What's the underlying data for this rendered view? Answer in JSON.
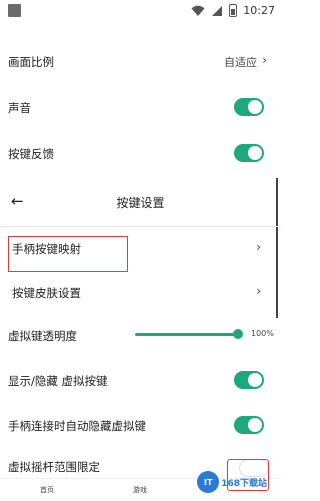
{
  "status": {
    "time": "10:27"
  },
  "settings_top": [
    {
      "label": "画面比例",
      "value": "自适应"
    },
    {
      "label": "声音"
    },
    {
      "label": "按键反馈"
    }
  ],
  "key_settings": {
    "title": "按键设置",
    "items": [
      {
        "label": "手柄按键映射"
      },
      {
        "label": "按键皮肤设置"
      },
      {
        "label": "虚拟键透明度",
        "value": "100%"
      },
      {
        "label": "显示/隐藏 虚拟按键"
      },
      {
        "label": "手柄连接时自动隐藏虚拟键"
      },
      {
        "label": "虚拟摇杆范围限定"
      }
    ],
    "opacity_level": 1.0
  },
  "bottom_nav": [
    "首页",
    "游戏"
  ],
  "brand": {
    "logo_text": "IT",
    "text": "168下载站"
  },
  "colors": {
    "accent": "#1fa87b",
    "highlight": "#e23b3b"
  }
}
